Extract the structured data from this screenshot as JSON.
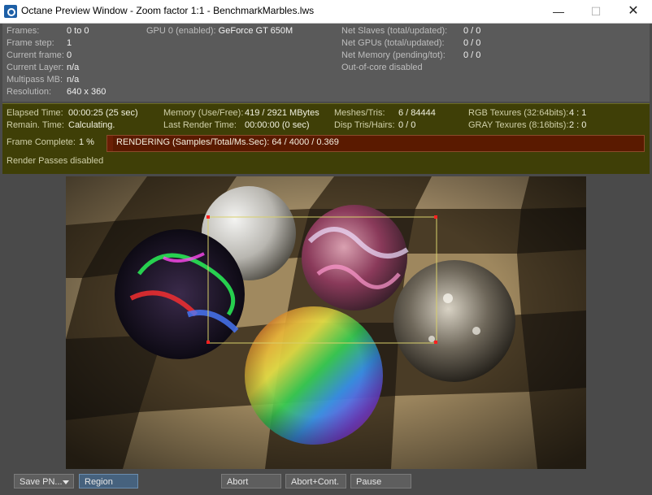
{
  "window": {
    "title": "Octane Preview Window - Zoom factor 1:1 - BenchmarkMarbles.lws",
    "minimize": "—",
    "maximize": "☐",
    "close": "✕"
  },
  "info": {
    "frames_label": "Frames:",
    "frames_value": "0 to 0",
    "frame_step_label": "Frame step:",
    "frame_step_value": "1",
    "current_frame_label": "Current frame:",
    "current_frame_value": "0",
    "current_layer_label": "Current Layer:",
    "current_layer_value": "n/a",
    "multipass_label": "Multipass MB:",
    "multipass_value": "n/a",
    "resolution_label": "Resolution:",
    "resolution_value": "640 x 360",
    "gpu_label": "GPU  0 (enabled):",
    "gpu_value": "GeForce GT 650M",
    "net_slaves_label": "Net Slaves (total/updated):",
    "net_slaves_value": "0 / 0",
    "net_gpus_label": "Net GPUs (total/updated):",
    "net_gpus_value": "0 / 0",
    "net_memory_label": "Net Memory (pending/tot):",
    "net_memory_value": "0 / 0",
    "out_of_core": "Out-of-core disabled"
  },
  "status": {
    "elapsed_label": "Elapsed Time:",
    "elapsed_value": "00:00:25 (25 sec)",
    "remain_label": "Remain. Time:",
    "remain_value": "Calculating.",
    "memory_label": "Memory (Use/Free):",
    "memory_value": "419 / 2921 MBytes",
    "last_render_label": "Last Render Time:",
    "last_render_value": "00:00:00 (0 sec)",
    "meshes_label": "Meshes/Tris:",
    "meshes_value": "6 / 84444",
    "disp_label": "Disp Tris/Hairs:",
    "disp_value": "0 / 0",
    "rgb_label": "RGB Texures (32:64bits):",
    "rgb_value": "4 : 1",
    "gray_label": "GRAY Texures (8:16bits):",
    "gray_value": "2 : 0",
    "frame_complete_label": "Frame Complete:",
    "frame_complete_value": "1 %",
    "progress_fraction": 0.01,
    "rendering_text": "RENDERING (Samples/Total/Ms.Sec): 64 / 4000 / 0.369",
    "render_passes": "Render Passes disabled"
  },
  "buttons": {
    "save": "Save PN...",
    "region": "Region",
    "abort": "Abort",
    "abort_cont": "Abort+Cont.",
    "pause": "Pause"
  }
}
